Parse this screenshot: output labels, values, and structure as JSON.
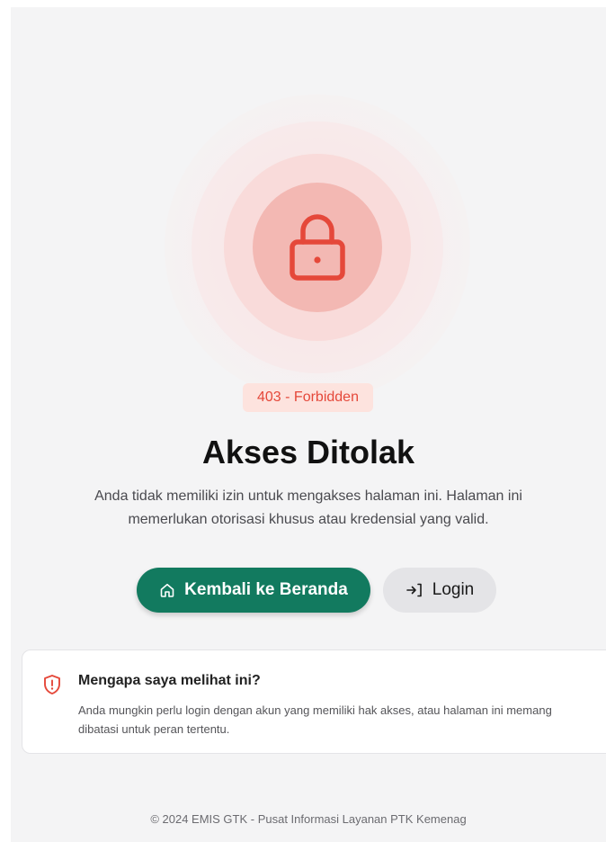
{
  "error": {
    "badge": "403 - Forbidden",
    "title": "Akses Ditolak",
    "description": "Anda tidak memiliki izin untuk mengakses halaman ini. Halaman ini memerlukan otorisasi khusus atau kredensial yang valid."
  },
  "actions": {
    "home_label": "Kembali ke Beranda",
    "login_label": "Login"
  },
  "info": {
    "title": "Mengapa saya melihat ini?",
    "text": "Anda mungkin perlu login dengan akun yang memiliki hak akses, atau halaman ini memang dibatasi untuk peran tertentu."
  },
  "footer": {
    "text": "© 2024 EMIS GTK - Pusat Informasi Layanan PTK Kemenag"
  },
  "icons": {
    "hero": "lock-icon",
    "home": "home-icon",
    "login": "login-icon",
    "info": "shield-alert-icon"
  },
  "colors": {
    "accent_danger": "#e5483a",
    "primary_button": "#127a5f",
    "secondary_button": "#e4e4e7",
    "background": "#f4f4f5"
  }
}
